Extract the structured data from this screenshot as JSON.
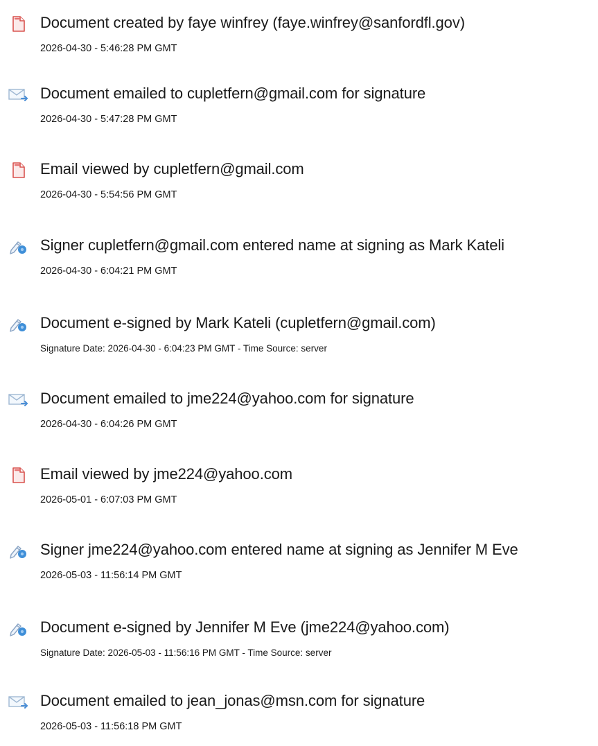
{
  "events": [
    {
      "icon": "document-created-icon",
      "title": "Document created by faye winfrey (faye.winfrey@sanfordfl.gov)",
      "timestamp": "2026-04-30 - 5:46:28 PM GMT"
    },
    {
      "icon": "email-sent-icon",
      "title": "Document emailed to cupletfern@gmail.com for signature",
      "timestamp": "2026-04-30 - 5:47:28 PM GMT"
    },
    {
      "icon": "email-viewed-icon",
      "title": "Email viewed by cupletfern@gmail.com",
      "timestamp": "2026-04-30 - 5:54:56 PM GMT"
    },
    {
      "icon": "signer-icon",
      "title": "Signer cupletfern@gmail.com entered name at signing as Mark Kateli",
      "timestamp": "2026-04-30 - 6:04:21 PM GMT"
    },
    {
      "icon": "e-signed-icon",
      "title": "Document e-signed by Mark Kateli (cupletfern@gmail.com)",
      "timestamp": "Signature Date: 2026-04-30 - 6:04:23 PM GMT - Time Source: server"
    },
    {
      "icon": "email-sent-icon",
      "title": "Document emailed to jme224@yahoo.com for signature",
      "timestamp": "2026-04-30 - 6:04:26 PM GMT"
    },
    {
      "icon": "email-viewed-icon",
      "title": "Email viewed by jme224@yahoo.com",
      "timestamp": "2026-05-01 - 6:07:03 PM GMT"
    },
    {
      "icon": "signer-icon",
      "title": "Signer jme224@yahoo.com entered name at signing as Jennifer M Eve",
      "timestamp": "2026-05-03 - 11:56:14 PM GMT"
    },
    {
      "icon": "e-signed-icon",
      "title": "Document e-signed by Jennifer M Eve (jme224@yahoo.com)",
      "timestamp": "Signature Date: 2026-05-03 - 11:56:16 PM GMT - Time Source: server"
    },
    {
      "icon": "email-sent-icon",
      "title": "Document emailed to jean_jonas@msn.com for signature",
      "timestamp": "2026-05-03 - 11:56:18 PM GMT"
    }
  ]
}
